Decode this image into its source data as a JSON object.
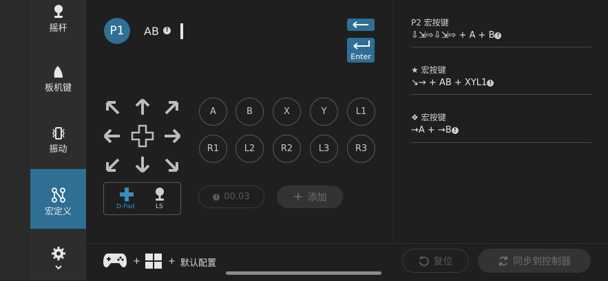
{
  "nav": {
    "items": [
      {
        "label": "摇杆",
        "icon": "joystick-icon"
      },
      {
        "label": "板机键",
        "icon": "trigger-icon"
      },
      {
        "label": "振动",
        "icon": "vibration-icon"
      },
      {
        "label": "宏定义",
        "icon": "macro-icon",
        "active": true
      },
      {
        "label": "",
        "icon": "gear-icon"
      }
    ]
  },
  "editor": {
    "player": "P1",
    "current_sequence": "AB",
    "enter_label": "Enter",
    "face_buttons_row1": [
      "A",
      "B",
      "X",
      "Y",
      "L1"
    ],
    "face_buttons_row2": [
      "R1",
      "L2",
      "R2",
      "L3",
      "R3"
    ],
    "dpad_label": "D-Pad",
    "ls_label": "LS",
    "timer_value": "00.03",
    "add_label": "添加"
  },
  "macros": [
    {
      "title": "P2 宏按键",
      "sequence": "⇩⇲⇨⇩⇲⇨ + A + B"
    },
    {
      "title": "★ 宏按键",
      "sequence": "↘→ + AB + XYL1"
    },
    {
      "title": "❖ 宏按键",
      "sequence": "→A + →B"
    }
  ],
  "bottom": {
    "plus1": "+",
    "plus2": "+",
    "config_label": "默认配置",
    "reset_label": "复位",
    "sync_label": "同步到控制器"
  },
  "colors": {
    "accent": "#2f6f93",
    "dpad_blue": "#3a8cc0"
  }
}
